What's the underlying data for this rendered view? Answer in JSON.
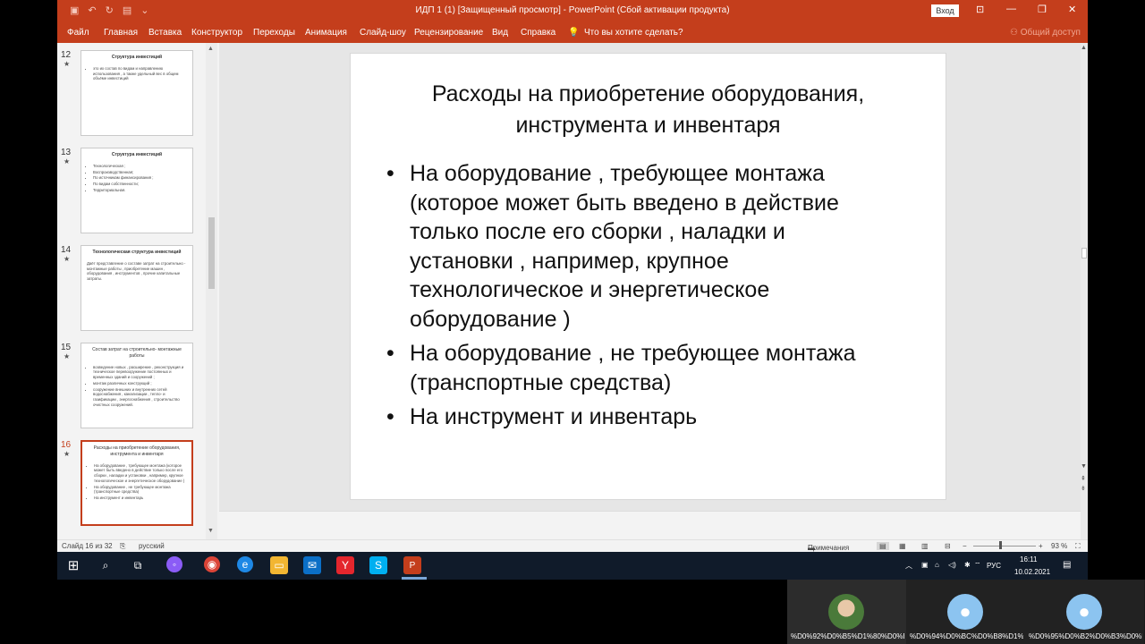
{
  "titlebar": {
    "title": "ИДП 1 (1) [Защищенный просмотр]  -  PowerPoint (Сбой активации продукта)",
    "login_label": "Вход"
  },
  "ribbon": {
    "tabs": [
      "Файл",
      "Главная",
      "Вставка",
      "Конструктор",
      "Переходы",
      "Анимация",
      "Слайд-шоу",
      "Рецензирование",
      "Вид",
      "Справка"
    ],
    "tellme": "Что вы хотите сделать?",
    "share": "Общий доступ"
  },
  "thumbnails": [
    {
      "num": "12",
      "title": "Структура инвестиций",
      "bullets": [
        "это их состав по видам и направлению использования , а также удельный вес в общем объёме инвестиций"
      ]
    },
    {
      "num": "13",
      "title": "Структура инвестиций",
      "bullets": [
        "Технологическая ;",
        "Воспроизводственная;",
        "По источникам финансирования ;",
        "По видам собственности;",
        "Территориальная."
      ]
    },
    {
      "num": "14",
      "title": "Технологическая структура инвестиций",
      "text": "Даёт представление о составе затрат на строительно - монтажные работы , приобретение машин , оборудования , инструментов , прочие капитальные затраты."
    },
    {
      "num": "15",
      "title": "Состав затрат на строительно- монтажные работы",
      "bullets": [
        "возведение новых , расширение , реконструкция и техническое перевооружение постоянных и временных зданий и сооружений ;",
        "монтаж различных конструкций ;",
        "сооружение внешних и внутренних сетей водоснабжения , канализации , тепло- и газификации , энергоснабжения , строительство очистных сооружений."
      ]
    },
    {
      "num": "16",
      "title": "Расходы на приобретение оборудования, инструмента и инвентаря",
      "bullets": [
        "На оборудование , требующее монтажа (которое может быть введено в действие только после его сборки , наладки и установки , например, крупное технологическое и энергетическое оборудование )",
        "На оборудование , не требующее монтажа (транспортные средства)",
        "На инструмент и инвентарь"
      ]
    }
  ],
  "slide": {
    "title_line1": "Расходы на приобретение оборудования,",
    "title_line2": "инструмента и инвентаря",
    "bullets": [
      [
        "На оборудование , требующее монтажа",
        "(которое может быть введено в действие",
        "только после его сборки , наладки и",
        "установки , например, крупное",
        "технологическое и энергетическое",
        "оборудование )"
      ],
      [
        "На оборудование , не требующее монтажа",
        "(транспортные средства)"
      ],
      [
        "На инструмент и инвентарь"
      ]
    ]
  },
  "statusbar": {
    "slide_counter": "Слайд 16 из 32",
    "language": "русский",
    "notes": "Примечания",
    "zoom": "93 %"
  },
  "taskbar": {
    "lang": "РУС",
    "time": "16:11",
    "date": "10.02.2021"
  },
  "meeting": [
    "%D0%92%D0%B5%D1%80%D0%B0...",
    "%D0%94%D0%BC%D0%B8%D1%8...",
    "%D0%95%D0%B2%D0%B3%D0%B..."
  ],
  "colors": {
    "accent": "#c43e1c",
    "taskbar": "#101b2a"
  }
}
